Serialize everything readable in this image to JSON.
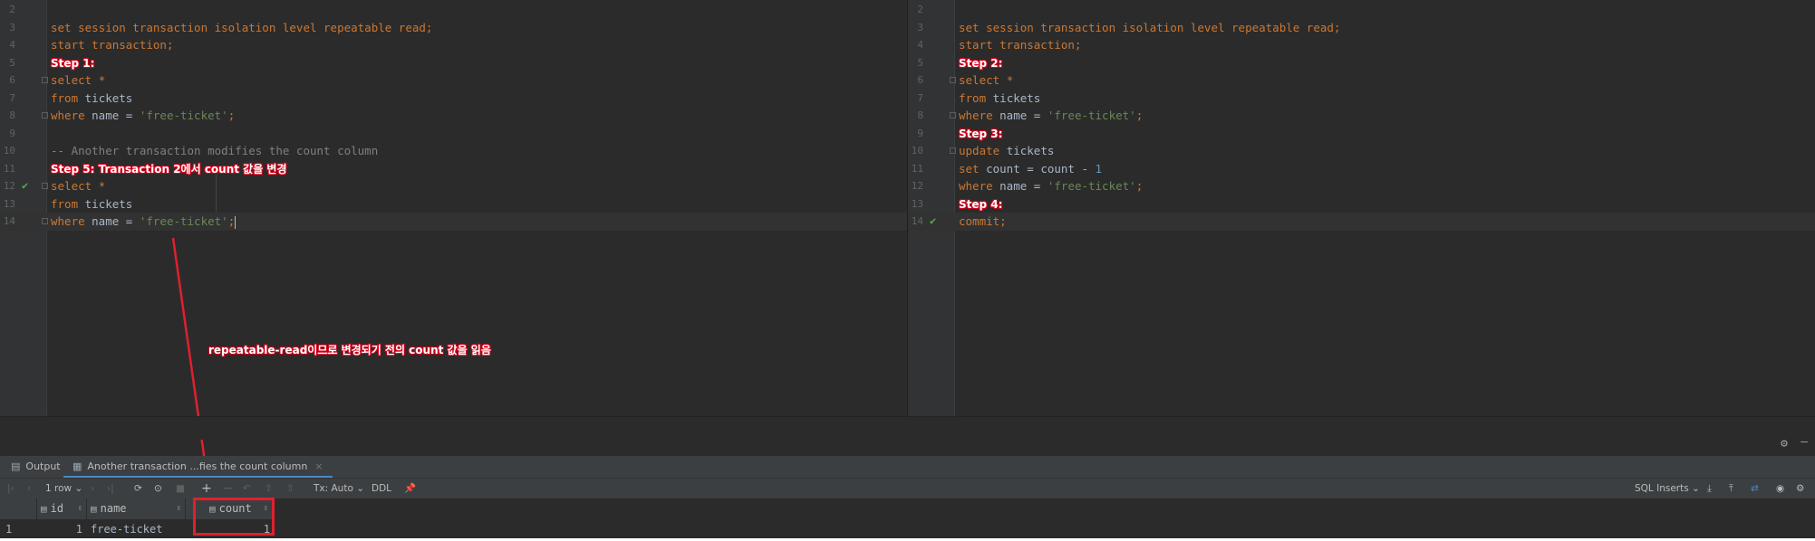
{
  "editor_left": {
    "lines": [
      {
        "num": "2",
        "segments": []
      },
      {
        "num": "3",
        "segments": [
          {
            "cls": "kw",
            "text": "set session transaction isolation level repeatable read;"
          }
        ]
      },
      {
        "num": "4",
        "segments": [
          {
            "cls": "kw",
            "text": "start transaction;"
          }
        ]
      },
      {
        "num": "5",
        "segments": [
          {
            "cls": "step",
            "text": "Step 1:"
          }
        ]
      },
      {
        "num": "6",
        "fold": true,
        "segments": [
          {
            "cls": "kw",
            "text": "select "
          },
          {
            "cls": "kw",
            "text": "*"
          }
        ]
      },
      {
        "num": "7",
        "segments": [
          {
            "cls": "kw",
            "text": "from "
          },
          {
            "cls": "plain",
            "text": "tickets"
          }
        ]
      },
      {
        "num": "8",
        "fold": true,
        "segments": [
          {
            "cls": "kw",
            "text": "where "
          },
          {
            "cls": "plain",
            "text": "name = "
          },
          {
            "cls": "str",
            "text": "'free-ticket'"
          },
          {
            "cls": "kw",
            "text": ";"
          }
        ]
      },
      {
        "num": "9",
        "segments": []
      },
      {
        "num": "10",
        "segments": [
          {
            "cls": "cmt",
            "text": "-- Another transaction modifies the count column"
          }
        ]
      },
      {
        "num": "11",
        "segments": [
          {
            "cls": "step",
            "text": "Step 5: Transaction 2에서 count 값을 변경"
          }
        ]
      },
      {
        "num": "12",
        "check": true,
        "fold": true,
        "segments": [
          {
            "cls": "kw",
            "text": "select "
          },
          {
            "cls": "kw",
            "text": "*"
          }
        ]
      },
      {
        "num": "13",
        "segments": [
          {
            "cls": "kw",
            "text": "from "
          },
          {
            "cls": "plain",
            "text": "tickets"
          }
        ]
      },
      {
        "num": "14",
        "current": true,
        "fold": true,
        "caret": true,
        "segments": [
          {
            "cls": "kw",
            "text": "where "
          },
          {
            "cls": "plain",
            "text": "name = "
          },
          {
            "cls": "str",
            "text": "'free-ticket'"
          },
          {
            "cls": "kw",
            "text": ";"
          }
        ]
      }
    ]
  },
  "editor_right": {
    "lines": [
      {
        "num": "2",
        "segments": []
      },
      {
        "num": "3",
        "segments": [
          {
            "cls": "kw",
            "text": "set session transaction isolation level repeatable read;"
          }
        ]
      },
      {
        "num": "4",
        "segments": [
          {
            "cls": "kw",
            "text": "start transaction;"
          }
        ]
      },
      {
        "num": "5",
        "segments": [
          {
            "cls": "step",
            "text": "Step 2:"
          }
        ]
      },
      {
        "num": "6",
        "fold": true,
        "segments": [
          {
            "cls": "kw",
            "text": "select "
          },
          {
            "cls": "kw",
            "text": "*"
          }
        ]
      },
      {
        "num": "7",
        "segments": [
          {
            "cls": "kw",
            "text": "from "
          },
          {
            "cls": "plain",
            "text": "tickets"
          }
        ]
      },
      {
        "num": "8",
        "fold": true,
        "segments": [
          {
            "cls": "kw",
            "text": "where "
          },
          {
            "cls": "plain",
            "text": "name = "
          },
          {
            "cls": "str",
            "text": "'free-ticket'"
          },
          {
            "cls": "kw",
            "text": ";"
          }
        ]
      },
      {
        "num": "9",
        "segments": [
          {
            "cls": "step",
            "text": "Step 3:"
          }
        ]
      },
      {
        "num": "10",
        "fold": true,
        "segments": [
          {
            "cls": "kw",
            "text": "update "
          },
          {
            "cls": "plain",
            "text": "tickets"
          }
        ]
      },
      {
        "num": "11",
        "segments": [
          {
            "cls": "kw",
            "text": "set "
          },
          {
            "cls": "plain",
            "text": "count = count - "
          },
          {
            "cls": "num",
            "text": "1"
          }
        ]
      },
      {
        "num": "12",
        "segments": [
          {
            "cls": "kw",
            "text": "where "
          },
          {
            "cls": "plain",
            "text": "name = "
          },
          {
            "cls": "str",
            "text": "'free-ticket'"
          },
          {
            "cls": "kw",
            "text": ";"
          }
        ]
      },
      {
        "num": "13",
        "segments": [
          {
            "cls": "step",
            "text": "Step 4:"
          }
        ]
      },
      {
        "num": "14",
        "current": true,
        "check": true,
        "segments": [
          {
            "cls": "kw",
            "text": "commit;"
          }
        ]
      }
    ]
  },
  "annotation": "repeatable-read이므로 변경되기 전의 count 값을 읽음",
  "tabs": [
    {
      "label": "Output",
      "icon": "output-icon",
      "active": false
    },
    {
      "label": "Another transaction ...fies the count column",
      "icon": "table-icon",
      "active": true
    }
  ],
  "toolbar": {
    "rows": "1 row",
    "tx": "Tx: Auto",
    "ddl": "DDL",
    "export_format": "SQL Inserts"
  },
  "grid": {
    "columns": [
      "id",
      "name",
      "count"
    ],
    "rows": [
      {
        "row_num": "1",
        "id": "1",
        "name": "free-ticket",
        "count": "1"
      }
    ]
  },
  "colors": {
    "keyword": "#cc7832",
    "string": "#6a8759",
    "number": "#6897bb",
    "comment": "#808080",
    "annotation_red": "#e0202d"
  }
}
